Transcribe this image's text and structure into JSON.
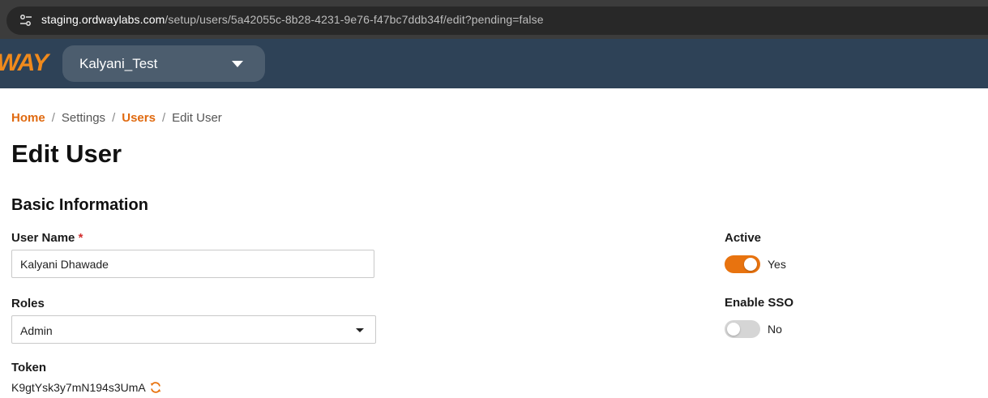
{
  "browser": {
    "url_host": "staging.ordwaylabs.com",
    "url_path": "/setup/users/5a42055c-8b28-4231-9e76-f47bc7ddb34f/edit?pending=false"
  },
  "header": {
    "logo_text": "WAY",
    "tenant": "Kalyani_Test"
  },
  "breadcrumb": {
    "home": "Home",
    "settings": "Settings",
    "users": "Users",
    "current": "Edit User"
  },
  "page": {
    "title": "Edit User",
    "section": "Basic Information"
  },
  "form": {
    "username_label": "User Name",
    "required_mark": "*",
    "username_value": "Kalyani Dhawade",
    "roles_label": "Roles",
    "roles_value": "Admin",
    "token_label": "Token",
    "token_value": "K9gtYsk3y7mN194s3UmA",
    "active_label": "Active",
    "active_state": "Yes",
    "sso_label": "Enable SSO",
    "sso_state": "No"
  },
  "colors": {
    "accent": "#e8730f",
    "header_bg": "#2e4257"
  },
  "icons": {
    "site_info": "tune-icon",
    "tenant_caret": "chevron-down-icon",
    "select_arrow": "caret-down-icon",
    "token_refresh": "refresh-icon"
  }
}
